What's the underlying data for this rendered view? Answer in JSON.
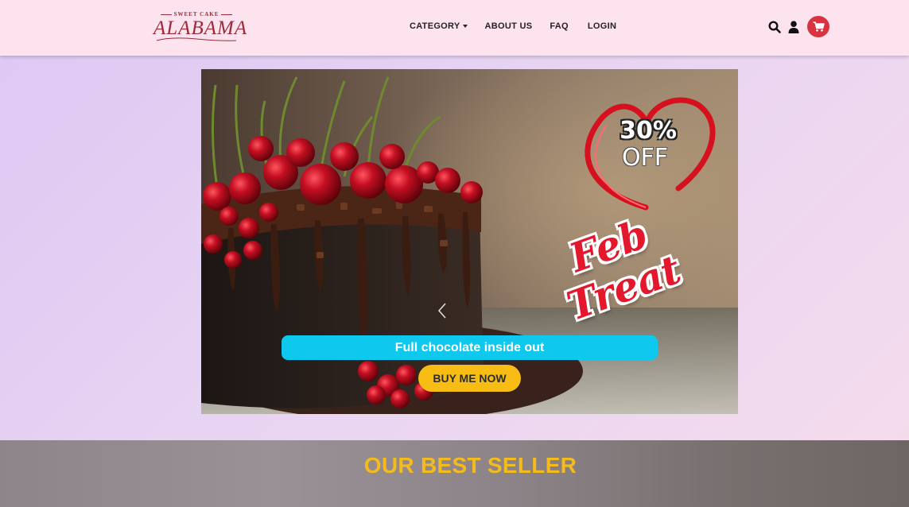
{
  "brand": {
    "tagline": "SWEET CAKE",
    "name": "ALABAMA"
  },
  "nav": {
    "items": [
      {
        "label": "CATEGORY",
        "has_dropdown": true
      },
      {
        "label": "ABOUT US"
      },
      {
        "label": "FAQ"
      },
      {
        "label": "LOGIN"
      }
    ]
  },
  "icons": {
    "search": "search-icon",
    "user": "user-icon",
    "cart": "cart-icon"
  },
  "hero": {
    "promo_percent": "30%",
    "promo_off": "OFF",
    "promo_title": "Feb Treat",
    "caption": "Full chocolate inside out",
    "cta_label": "BUY ME NOW"
  },
  "section": {
    "best_seller_title": "OUR BEST SELLER"
  },
  "colors": {
    "header_bg": "#fde3ee",
    "cart_red": "#d8333f",
    "caption_cyan": "#0fc8ee",
    "cta_yellow": "#f7bd14",
    "heading_gold": "#f4bb1c",
    "brand_maroon": "#9b2a3b"
  }
}
